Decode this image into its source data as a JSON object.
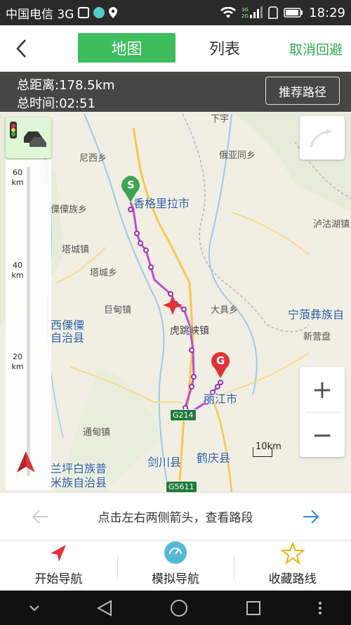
{
  "status": {
    "carrier": "中国电信 3G",
    "time": "18:29"
  },
  "topbar": {
    "tab_map": "地图",
    "tab_list": "列表",
    "cancel_label": "取消回避"
  },
  "route_info": {
    "distance": "总距离:178.5km",
    "duration": "总时间:02:51",
    "recommend_label": "推荐路径"
  },
  "scale": {
    "marks": [
      {
        "value": "60",
        "unit": "km"
      },
      {
        "value": "40",
        "unit": "km"
      },
      {
        "value": "20",
        "unit": "km"
      }
    ],
    "bar_label": "10km"
  },
  "map_labels": {
    "shangri_la": "香格里拉市",
    "lijiang": "丽江市",
    "jianchuan": "剑川县",
    "heqing": "鹤庆县",
    "nixi": "尼西乡",
    "lisu": "傈僳族乡",
    "talcheng_town": "塔城镇",
    "talcheng_xiang": "塔城乡",
    "judian": "巨甸镇",
    "hutiao": "虎跳峡镇",
    "daju": "大具乡",
    "eya": "俄亚同乡",
    "ninglang": "宁蒗彝族自",
    "xinying": "新营盘",
    "luguhu": "泸沽湖镇",
    "tongdian": "通甸镇",
    "weixi": "西傈僳\n自治县",
    "lanping": "兰坪白族普\n米族自治县",
    "xiayu": "下宇"
  },
  "roads": {
    "g214": "G214",
    "g5611": "G5611"
  },
  "markers": {
    "start": "S",
    "end": "G"
  },
  "segment_nav": {
    "hint": "点击左右两侧箭头，查看路段"
  },
  "actions": {
    "start_nav": "开始导航",
    "sim_nav": "模拟导航",
    "fav_route": "收藏路线"
  },
  "colors": {
    "accent": "#3dbd5d",
    "route": "#b94fcf",
    "start_pin": "#3aa64d",
    "end_pin": "#e0333a"
  }
}
